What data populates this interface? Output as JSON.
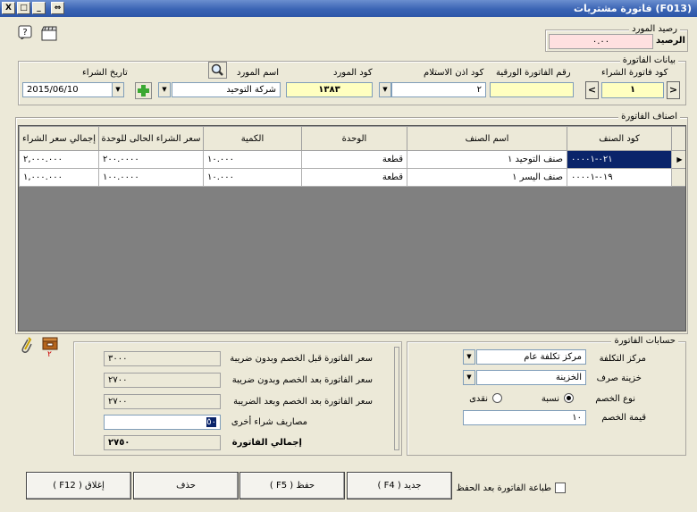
{
  "window": {
    "title": "(F013) فاتورة مشتريات",
    "buttons": {
      "restore": "⇔",
      "minimize": "_",
      "maximize": "□",
      "close": "X"
    }
  },
  "toolbar": {
    "help_icon": "?"
  },
  "supplier_balance": {
    "group_label": "رصيد المورد",
    "balance_label": "الرصيد",
    "balance_value": "٠.٠٠"
  },
  "invoice_data": {
    "group_label": "بيانات الفاتورة",
    "purchase_invoice_code_label": "كود فاتورة الشراء",
    "purchase_invoice_code_value": "١",
    "nav_next": ">",
    "nav_prev": "<",
    "paper_invoice_number_label": "رقم الفاتورة الورقية",
    "paper_invoice_number_value": "",
    "receipt_code_label": "كود اذن الاستلام",
    "receipt_code_value": "٢",
    "supplier_code_label": "كود المورد",
    "supplier_code_value": "١٣٨٣",
    "supplier_name_label": "اسم المورد",
    "supplier_name_value": "شركة التوحيد",
    "purchase_date_label": "تاريخ الشراء",
    "purchase_date_value": "2015/06/10",
    "add_icon": "+"
  },
  "invoice_items": {
    "group_label": "اصناف الفاتورة",
    "columns": [
      "كود الصنف",
      "اسم الصنف",
      "الوحدة",
      "الكمية",
      "سعر الشراء الحالى للوحدة",
      "إجمالي سعر الشراء"
    ],
    "rows": [
      {
        "marker": "▶",
        "item_code": "٠٢١-٠٠٠٠١",
        "item_name": "صنف التوحيد ١",
        "unit": "قطعة",
        "quantity": "١٠.٠٠٠",
        "unit_price": "٢٠٠.٠٠٠٠",
        "total": "٢,٠٠٠.٠٠٠"
      },
      {
        "marker": "",
        "item_code": "٠١٩-٠٠٠٠١",
        "item_name": "صنف اليسر ١",
        "unit": "قطعة",
        "quantity": "١٠.٠٠٠",
        "unit_price": "١٠٠.٠٠٠٠",
        "total": "١,٠٠٠.٠٠٠"
      }
    ]
  },
  "invoice_accounts": {
    "group_label": "حسابات الفاتورة",
    "cost_center_label": "مركز التكلفة",
    "cost_center_value": "مركز تكلفة عام",
    "cashbox_label": "خزينة صرف",
    "cashbox_value": "الخزينة",
    "discount_type_label": "نوع الخصم",
    "discount_percent_label": "نسبة",
    "discount_cash_label": "نقدى",
    "discount_value_label": "قيمة الخصم",
    "discount_value": "١٠"
  },
  "totals": {
    "before_discount_label": "سعر الفاتورة قبل الخصم وبدون ضريبة",
    "before_discount_value": "٣٠٠٠",
    "after_discount_label": "سعر الفاتورة بعد الخصم وبدون ضريبة",
    "after_discount_value": "٢٧٠٠",
    "after_discount_tax_label": "سعر الفاتورة بعد الخصم وبعد الضريبة",
    "after_discount_tax_value": "٢٧٠٠",
    "other_expenses_label": "مصاريف شراء أخرى",
    "other_expenses_value": "٥٠",
    "invoice_total_label": "إجمالي الفاتورة",
    "invoice_total_value": "٢٧٥٠"
  },
  "attachments": {
    "badge_count": "٢"
  },
  "footer": {
    "print_after_save_label": "طباعة الفاتورة بعد الحفظ",
    "new_button": "جديد ( F4 )",
    "save_button": "حفظ ( F5 )",
    "delete_button": "حذف",
    "close_button": "إغلاق ( F12 )"
  },
  "colors": {
    "title_blue": "#3a64b4",
    "selected_row": "#0a246a",
    "yellow_field": "#ffffc0",
    "pink_field": "#ffe0e0"
  }
}
